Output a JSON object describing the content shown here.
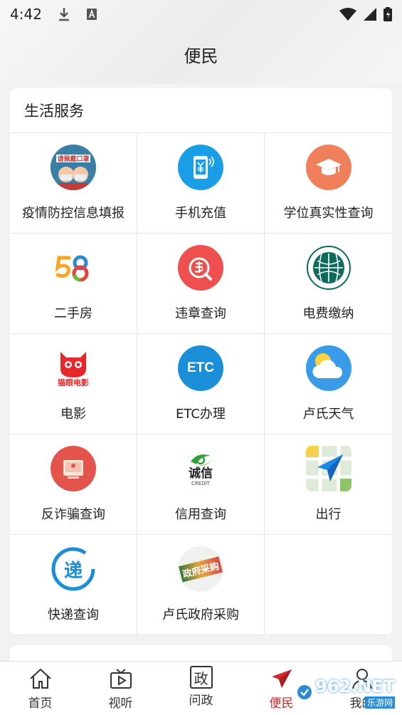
{
  "status_bar": {
    "time": "4:42"
  },
  "header": {
    "title": "便民"
  },
  "section": {
    "title": "生活服务",
    "items": [
      {
        "label": "疫情防控信息填报",
        "icon": "mask-poster-icon"
      },
      {
        "label": "手机充值",
        "icon": "phone-yuan-icon"
      },
      {
        "label": "学位真实性查询",
        "icon": "graduation-cap-icon"
      },
      {
        "label": "二手房",
        "icon": "58-logo-icon"
      },
      {
        "label": "违章查询",
        "icon": "violation-icon"
      },
      {
        "label": "电费缴纳",
        "icon": "state-grid-logo-icon"
      },
      {
        "label": "电影",
        "icon": "maoyan-cat-icon"
      },
      {
        "label": "ETC办理",
        "icon": "etc-icon"
      },
      {
        "label": "卢氏天气",
        "icon": "weather-cloud-sun-icon"
      },
      {
        "label": "反诈骗查询",
        "icon": "anti-fraud-icon"
      },
      {
        "label": "信用查询",
        "icon": "credit-logo-icon"
      },
      {
        "label": "出行",
        "icon": "navigation-icon"
      },
      {
        "label": "快递查询",
        "icon": "express-icon"
      },
      {
        "label": "卢氏政府采购",
        "icon": "gov-procurement-icon"
      }
    ],
    "icon_texts": {
      "etc": "ETC",
      "maoyan": "猫眼电影",
      "mask": "请佩戴口罩",
      "credit_cn": "诚信",
      "credit_en": "CREDIT",
      "express": "递",
      "procurement": "政府采购"
    }
  },
  "tabbar": {
    "tabs": [
      {
        "label": "首页"
      },
      {
        "label": "视听"
      },
      {
        "label": "问政"
      },
      {
        "label": "便民"
      },
      {
        "label": "我的"
      }
    ],
    "wenzheng_glyph": "政",
    "active_color": "#d4272c"
  },
  "watermark": {
    "text": "962.NET",
    "sub": "乐游网"
  }
}
